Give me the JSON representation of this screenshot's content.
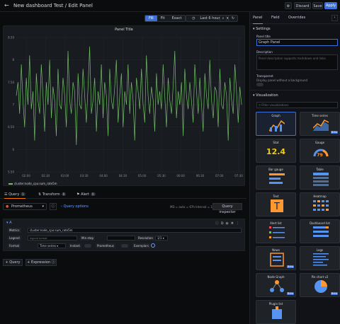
{
  "header": {
    "title": "New dashboard Test / Edit Panel",
    "discard": "Discard",
    "save": "Save",
    "apply": "Apply"
  },
  "toolbar": {
    "fill": "Fill",
    "fit": "Fit",
    "exact": "Exact",
    "time_range": "Last 6 hours"
  },
  "panel": {
    "title": "Panel Title",
    "legend": "cluster:node_cpu:sum_rate5m"
  },
  "chart_data": {
    "type": "line",
    "title": "Panel Title",
    "y_ticks": [
      "8.50",
      "8",
      "7.50",
      "7",
      "6.50",
      "6",
      "5.50"
    ],
    "x_ticks": [
      "02:00",
      "02:30",
      "03:00",
      "03:30",
      "04:00",
      "04:30",
      "05:00",
      "05:30",
      "06:00",
      "06:30",
      "07:00",
      "07:30"
    ],
    "ylim": [
      5.5,
      8.5
    ],
    "series": [
      {
        "name": "cluster:node_cpu:sum_rate5m",
        "color": "#73bf69",
        "values": [
          7.2,
          7.5,
          6.8,
          7.9,
          7.1,
          6.5,
          7.6,
          7.0,
          8.1,
          6.9,
          7.3,
          6.2,
          7.7,
          7.1,
          6.8,
          7.9,
          7.2,
          6.4,
          7.5,
          7.0,
          8.0,
          6.7,
          7.4,
          7.1,
          6.3,
          7.8,
          7.0,
          6.9,
          7.6,
          7.2,
          6.5,
          8.2,
          7.1,
          6.8,
          7.5,
          7.3,
          6.1,
          7.7,
          7.0,
          6.9,
          7.8,
          7.2,
          6.6,
          7.4,
          8.3,
          6.8,
          7.1,
          7.6,
          6.4,
          7.3,
          7.0,
          7.9,
          6.7,
          7.5,
          7.2,
          6.3,
          7.8,
          7.1,
          6.9,
          7.4,
          8.0,
          6.6,
          7.2,
          7.7,
          6.5,
          7.3,
          7.0,
          7.9,
          6.8,
          7.5,
          7.1,
          6.2,
          7.6,
          7.3,
          6.9,
          7.8,
          7.0,
          6.6,
          8.1,
          7.2,
          6.8,
          7.4,
          7.1,
          6.4,
          7.7,
          7.0,
          7.3,
          6.9,
          7.9,
          7.2,
          6.5,
          7.6,
          7.1,
          6.8,
          7.4,
          8.2,
          6.7,
          7.3,
          7.0,
          7.5,
          6.3,
          7.8,
          7.2,
          6.9,
          7.5,
          7.1,
          6.6,
          7.9,
          7.3,
          6.8,
          7.6,
          7.0,
          6.4,
          7.7,
          7.2,
          6.9,
          8.0,
          7.1,
          6.7,
          7.4,
          7.3,
          6.5,
          7.8,
          7.0,
          6.9,
          7.5,
          7.2,
          6.2,
          7.6,
          7.1,
          6.8,
          7.9,
          7.3,
          6.6,
          7.4,
          7.0
        ]
      }
    ]
  },
  "query_tabs": {
    "query": "Query",
    "query_count": "1",
    "transform": "Transform",
    "transform_count": "0",
    "alert": "Alert",
    "alert_count": "0"
  },
  "query": {
    "datasource": "Prometheus",
    "options": "Query options",
    "meta": "MD = auto = 67h   Interval = 1m",
    "inspector": "Query inspector",
    "ref": "A",
    "metrics_label": "Metrics",
    "metrics_value": "cluster:node_cpu:sum_rate5m",
    "legend_label": "Legend",
    "legend_placeholder": "legend format",
    "minstep_label": "Min step",
    "resolution_label": "Resolution",
    "resolution_value": "1/1",
    "format_label": "Format",
    "format_value": "Time series",
    "instant_label": "Instant",
    "prometheus_label": "Prometheus",
    "exemplars_label": "Exemplars",
    "add_query": "Query",
    "add_expression": "Expression"
  },
  "right_tabs": {
    "panel": "Panel",
    "field": "Field",
    "overrides": "Overrides"
  },
  "settings": {
    "header": "Settings",
    "title_label": "Panel title",
    "title_value": "Graph Panel",
    "desc_label": "Description",
    "desc_placeholder": "Panel description supports markdown and links.",
    "transparent_label": "Transparent",
    "transparent_help": "Display panel without a background"
  },
  "visualization": {
    "header": "Visualization",
    "filter_placeholder": "Filter visualizations",
    "cards": [
      {
        "name": "Graph",
        "icon": "graph-icon"
      },
      {
        "name": "Time series",
        "icon": "time-series-icon",
        "beta": "Beta"
      },
      {
        "name": "Stat",
        "icon": "stat-icon",
        "stat_value": "12.4"
      },
      {
        "name": "Gauge",
        "icon": "gauge-icon",
        "gauge_value": "79"
      },
      {
        "name": "Bar gauge",
        "icon": "bar-gauge-icon"
      },
      {
        "name": "Table",
        "icon": "table-icon"
      },
      {
        "name": "Text",
        "icon": "text-icon"
      },
      {
        "name": "Heatmap",
        "icon": "heatmap-icon"
      },
      {
        "name": "Alert list",
        "icon": "alert-list-icon"
      },
      {
        "name": "Dashboard list",
        "icon": "dashboard-list-icon"
      },
      {
        "name": "News",
        "icon": "news-icon",
        "beta": "Beta"
      },
      {
        "name": "Logs",
        "icon": "logs-icon"
      },
      {
        "name": "Node Graph",
        "icon": "node-graph-icon",
        "beta": "Beta"
      },
      {
        "name": "Pie chart v2",
        "icon": "pie-chart-icon",
        "beta": "Beta"
      },
      {
        "name": "Plugin list",
        "icon": "plugin-list-icon"
      }
    ]
  },
  "colors": {
    "accent": "#3d71d9",
    "series": "#73bf69",
    "tab_active": "#f57c00"
  }
}
